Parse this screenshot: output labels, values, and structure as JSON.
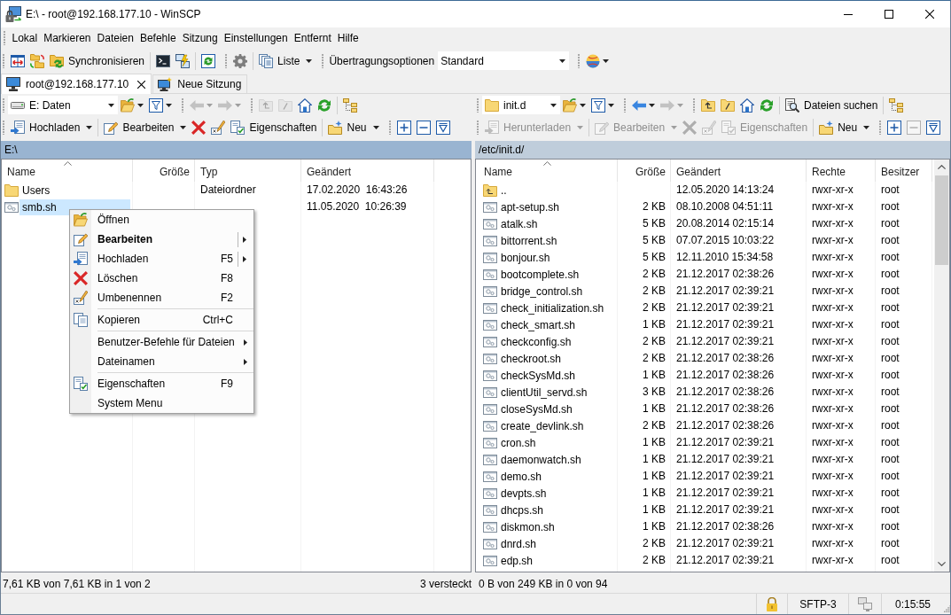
{
  "window": {
    "title": "E:\\ - root@192.168.177.10 - WinSCP"
  },
  "menu_bar": {
    "items": [
      "Lokal",
      "Markieren",
      "Dateien",
      "Befehle",
      "Sitzung",
      "Einstellungen",
      "Entfernt",
      "Hilfe"
    ]
  },
  "toolbar": {
    "bands": [
      {
        "items": [
          {
            "kind": "compare"
          },
          {
            "kind": "sync_folders"
          },
          {
            "kind": "synchronize",
            "label": "Synchronisieren"
          },
          {
            "kind": "separator"
          },
          {
            "kind": "terminal"
          },
          {
            "kind": "putty"
          },
          {
            "kind": "separator"
          },
          {
            "kind": "sync_browse"
          }
        ]
      },
      {
        "items": [
          {
            "kind": "settings"
          },
          {
            "kind": "separator"
          },
          {
            "kind": "view",
            "label": "Liste",
            "dropdown": true
          }
        ]
      },
      {
        "items": [
          {
            "kind": "label",
            "label": "Übertragungsoptionen"
          },
          {
            "kind": "combo",
            "value": "Standard"
          }
        ]
      },
      {
        "items": [
          {
            "kind": "transfer_settings",
            "dropdown": true
          }
        ]
      }
    ]
  },
  "session_tabs": [
    {
      "kind": "session",
      "label": "root@192.168.177.10",
      "selected": true
    },
    {
      "kind": "new",
      "label": "Neue Sitzung",
      "selected": false
    }
  ],
  "local_panel": {
    "active": true,
    "address_bar": {
      "bands": [
        {
          "items": [
            {
              "kind": "drive_combo",
              "value": "E: Daten",
              "disabled": false
            },
            {
              "kind": "open_dir",
              "dropdown": true,
              "disabled": false
            },
            {
              "kind": "filter",
              "dropdown": true,
              "disabled": false
            }
          ]
        },
        {
          "items": [
            {
              "kind": "back",
              "dropdown": true,
              "disabled": true
            },
            {
              "kind": "forward",
              "dropdown": true,
              "disabled": true
            }
          ]
        },
        {
          "items": [
            {
              "kind": "parent_dir",
              "disabled": true
            },
            {
              "kind": "root_dir",
              "disabled": true
            },
            {
              "kind": "home",
              "disabled": false
            },
            {
              "kind": "refresh",
              "disabled": false
            },
            {
              "kind": "separator"
            },
            {
              "kind": "tree",
              "disabled": false
            }
          ]
        }
      ]
    },
    "action_bar": {
      "bands": [
        {
          "items": [
            {
              "kind": "upload",
              "label": "Hochladen",
              "dropdown": true,
              "disabled": false
            },
            {
              "kind": "separator"
            },
            {
              "kind": "edit",
              "label": "Bearbeiten",
              "dropdown": true,
              "disabled": false
            },
            {
              "kind": "delete",
              "disabled": false
            },
            {
              "kind": "rename",
              "disabled": false
            },
            {
              "kind": "properties",
              "label": "Eigenschaften",
              "disabled": false
            },
            {
              "kind": "separator"
            },
            {
              "kind": "new",
              "label": "Neu",
              "dropdown": true,
              "disabled": false
            }
          ]
        },
        {
          "items": [
            {
              "kind": "select",
              "disabled": false
            },
            {
              "kind": "unselect",
              "disabled": false
            },
            {
              "kind": "filter_select",
              "disabled": false
            }
          ]
        }
      ]
    },
    "path": "E:\\",
    "columns": [
      {
        "label": "Name",
        "sorted": true
      },
      {
        "label": "Größe",
        "sorted": false
      },
      {
        "label": "Typ",
        "sorted": false
      },
      {
        "label": "Geändert",
        "sorted": false
      }
    ],
    "rows": [
      {
        "kind": "folder",
        "name": "Users",
        "type": "Dateiordner",
        "modified": "17.02.2020  16:43:26",
        "selected": false
      },
      {
        "kind": "script",
        "name": "smb.sh",
        "modified": "11.05.2020  10:26:39",
        "selected": true
      }
    ],
    "status": {
      "selection": "7,61 KB von 7,61 KB in 1 von 2",
      "hidden": "3 versteckt"
    }
  },
  "remote_panel": {
    "active": false,
    "address_bar": {
      "bands": [
        {
          "items": [
            {
              "kind": "folder_combo",
              "value": "init.d",
              "disabled": false
            },
            {
              "kind": "open_dir",
              "dropdown": true,
              "disabled": false
            },
            {
              "kind": "filter",
              "dropdown": true,
              "disabled": false
            }
          ]
        },
        {
          "items": [
            {
              "kind": "back",
              "dropdown": true,
              "disabled": false
            },
            {
              "kind": "forward",
              "dropdown": true,
              "disabled": true
            }
          ]
        },
        {
          "items": [
            {
              "kind": "parent_dir",
              "disabled": false
            },
            {
              "kind": "root_dir",
              "disabled": false
            },
            {
              "kind": "home",
              "disabled": false
            },
            {
              "kind": "refresh",
              "disabled": false
            },
            {
              "kind": "separator"
            },
            {
              "kind": "find",
              "label": "Dateien suchen",
              "disabled": false
            },
            {
              "kind": "separator"
            },
            {
              "kind": "tree",
              "disabled": false
            }
          ]
        }
      ]
    },
    "action_bar": {
      "bands": [
        {
          "items": [
            {
              "kind": "download",
              "label": "Herunterladen",
              "dropdown": true,
              "disabled": true
            },
            {
              "kind": "separator"
            },
            {
              "kind": "edit",
              "label": "Bearbeiten",
              "dropdown": true,
              "disabled": true
            },
            {
              "kind": "delete",
              "disabled": true
            },
            {
              "kind": "rename",
              "disabled": true
            },
            {
              "kind": "properties",
              "label": "Eigenschaften",
              "disabled": true
            },
            {
              "kind": "separator"
            },
            {
              "kind": "new",
              "label": "Neu",
              "dropdown": true,
              "disabled": false
            }
          ]
        },
        {
          "items": [
            {
              "kind": "select",
              "disabled": false
            },
            {
              "kind": "unselect",
              "disabled": true
            },
            {
              "kind": "filter_select",
              "disabled": false
            }
          ]
        }
      ]
    },
    "path": "/etc/init.d/",
    "columns": [
      {
        "label": "Name",
        "sorted": true
      },
      {
        "label": "Größe",
        "sorted": false
      },
      {
        "label": "Geändert",
        "sorted": false
      },
      {
        "label": "Rechte",
        "sorted": false
      },
      {
        "label": "Besitzer",
        "sorted": false
      }
    ],
    "rows": [
      {
        "kind": "parent",
        "name": "..",
        "modified": "12.05.2020 14:13:24",
        "rights": "rwxr-xr-x",
        "owner": "root",
        "selected": false
      },
      {
        "kind": "script",
        "name": "apt-setup.sh",
        "size": "2 KB",
        "modified": "08.10.2008 04:51:11",
        "rights": "rwxr-xr-x",
        "owner": "root",
        "selected": false
      },
      {
        "kind": "script",
        "name": "atalk.sh",
        "size": "5 KB",
        "modified": "20.08.2014 02:15:14",
        "rights": "rwxr-xr-x",
        "owner": "root",
        "selected": false
      },
      {
        "kind": "script",
        "name": "bittorrent.sh",
        "size": "5 KB",
        "modified": "07.07.2015 10:03:22",
        "rights": "rwxr-xr-x",
        "owner": "root",
        "selected": false
      },
      {
        "kind": "script",
        "name": "bonjour.sh",
        "size": "5 KB",
        "modified": "12.11.2010 15:34:58",
        "rights": "rwxr-xr-x",
        "owner": "root",
        "selected": false
      },
      {
        "kind": "script",
        "name": "bootcomplete.sh",
        "size": "2 KB",
        "modified": "21.12.2017 02:38:26",
        "rights": "rwxr-xr-x",
        "owner": "root",
        "selected": false
      },
      {
        "kind": "script",
        "name": "bridge_control.sh",
        "size": "2 KB",
        "modified": "21.12.2017 02:39:21",
        "rights": "rwxr-xr-x",
        "owner": "root",
        "selected": false
      },
      {
        "kind": "script",
        "name": "check_initialization.sh",
        "size": "2 KB",
        "modified": "21.12.2017 02:39:21",
        "rights": "rwxr-xr-x",
        "owner": "root",
        "selected": false
      },
      {
        "kind": "script",
        "name": "check_smart.sh",
        "size": "1 KB",
        "modified": "21.12.2017 02:39:21",
        "rights": "rwxr-xr-x",
        "owner": "root",
        "selected": false
      },
      {
        "kind": "script",
        "name": "checkconfig.sh",
        "size": "2 KB",
        "modified": "21.12.2017 02:39:21",
        "rights": "rwxr-xr-x",
        "owner": "root",
        "selected": false
      },
      {
        "kind": "script",
        "name": "checkroot.sh",
        "size": "2 KB",
        "modified": "21.12.2017 02:38:26",
        "rights": "rwxr-xr-x",
        "owner": "root",
        "selected": false
      },
      {
        "kind": "script",
        "name": "checkSysMd.sh",
        "size": "1 KB",
        "modified": "21.12.2017 02:38:26",
        "rights": "rwxr-xr-x",
        "owner": "root",
        "selected": false
      },
      {
        "kind": "script",
        "name": "clientUtil_servd.sh",
        "size": "3 KB",
        "modified": "21.12.2017 02:38:26",
        "rights": "rwxr-xr-x",
        "owner": "root",
        "selected": false
      },
      {
        "kind": "script",
        "name": "closeSysMd.sh",
        "size": "1 KB",
        "modified": "21.12.2017 02:38:26",
        "rights": "rwxr-xr-x",
        "owner": "root",
        "selected": false
      },
      {
        "kind": "script",
        "name": "create_devlink.sh",
        "size": "2 KB",
        "modified": "21.12.2017 02:38:26",
        "rights": "rwxr-xr-x",
        "owner": "root",
        "selected": false
      },
      {
        "kind": "script",
        "name": "cron.sh",
        "size": "1 KB",
        "modified": "21.12.2017 02:39:21",
        "rights": "rwxr-xr-x",
        "owner": "root",
        "selected": false
      },
      {
        "kind": "script",
        "name": "daemonwatch.sh",
        "size": "1 KB",
        "modified": "21.12.2017 02:39:21",
        "rights": "rwxr-xr-x",
        "owner": "root",
        "selected": false
      },
      {
        "kind": "script",
        "name": "demo.sh",
        "size": "1 KB",
        "modified": "21.12.2017 02:39:21",
        "rights": "rwxr-xr-x",
        "owner": "root",
        "selected": false
      },
      {
        "kind": "script",
        "name": "devpts.sh",
        "size": "1 KB",
        "modified": "21.12.2017 02:39:21",
        "rights": "rwxr-xr-x",
        "owner": "root",
        "selected": false
      },
      {
        "kind": "script",
        "name": "dhcps.sh",
        "size": "1 KB",
        "modified": "21.12.2017 02:39:21",
        "rights": "rwxr-xr-x",
        "owner": "root",
        "selected": false
      },
      {
        "kind": "script",
        "name": "diskmon.sh",
        "size": "1 KB",
        "modified": "21.12.2017 02:38:26",
        "rights": "rwxr-xr-x",
        "owner": "root",
        "selected": false
      },
      {
        "kind": "script",
        "name": "dnrd.sh",
        "size": "2 KB",
        "modified": "21.12.2017 02:39:21",
        "rights": "rwxr-xr-x",
        "owner": "root",
        "selected": false
      },
      {
        "kind": "script",
        "name": "edp.sh",
        "size": "2 KB",
        "modified": "21.12.2017 02:39:21",
        "rights": "rwxr-xr-x",
        "owner": "root",
        "selected": false
      }
    ],
    "status": {
      "selection": "0 B von 249 KB in 0 von 94"
    }
  },
  "context_menu": {
    "items": [
      {
        "kind": "open",
        "label": "Öffnen",
        "default": false,
        "submenu": false,
        "split": false
      },
      {
        "kind": "edit",
        "label": "Bearbeiten",
        "default": true,
        "submenu": true,
        "split": true
      },
      {
        "kind": "upload",
        "label": "Hochladen",
        "shortcut": "F5",
        "default": false,
        "submenu": true,
        "split": true
      },
      {
        "kind": "delete",
        "label": "Löschen",
        "shortcut": "F8",
        "default": false,
        "submenu": false,
        "split": false
      },
      {
        "kind": "rename",
        "label": "Umbenennen",
        "shortcut": "F2",
        "default": false,
        "submenu": false,
        "split": false
      },
      {
        "kind": "separator"
      },
      {
        "kind": "copy",
        "label": "Kopieren",
        "shortcut": "Ctrl+C",
        "default": false,
        "submenu": false,
        "split": false
      },
      {
        "kind": "separator"
      },
      {
        "kind": "commands",
        "label": "Benutzer-Befehle für Dateien",
        "default": false,
        "submenu": true,
        "split": false
      },
      {
        "kind": "filenames",
        "label": "Dateinamen",
        "default": false,
        "submenu": true,
        "split": false
      },
      {
        "kind": "separator"
      },
      {
        "kind": "properties",
        "label": "Eigenschaften",
        "shortcut": "F9",
        "default": false,
        "submenu": false,
        "split": false
      },
      {
        "kind": "system",
        "label": "System Menu",
        "default": false,
        "submenu": false,
        "split": false
      }
    ]
  },
  "status_bar": {
    "protocol": "SFTP-3",
    "elapsed": "0:15:55"
  }
}
